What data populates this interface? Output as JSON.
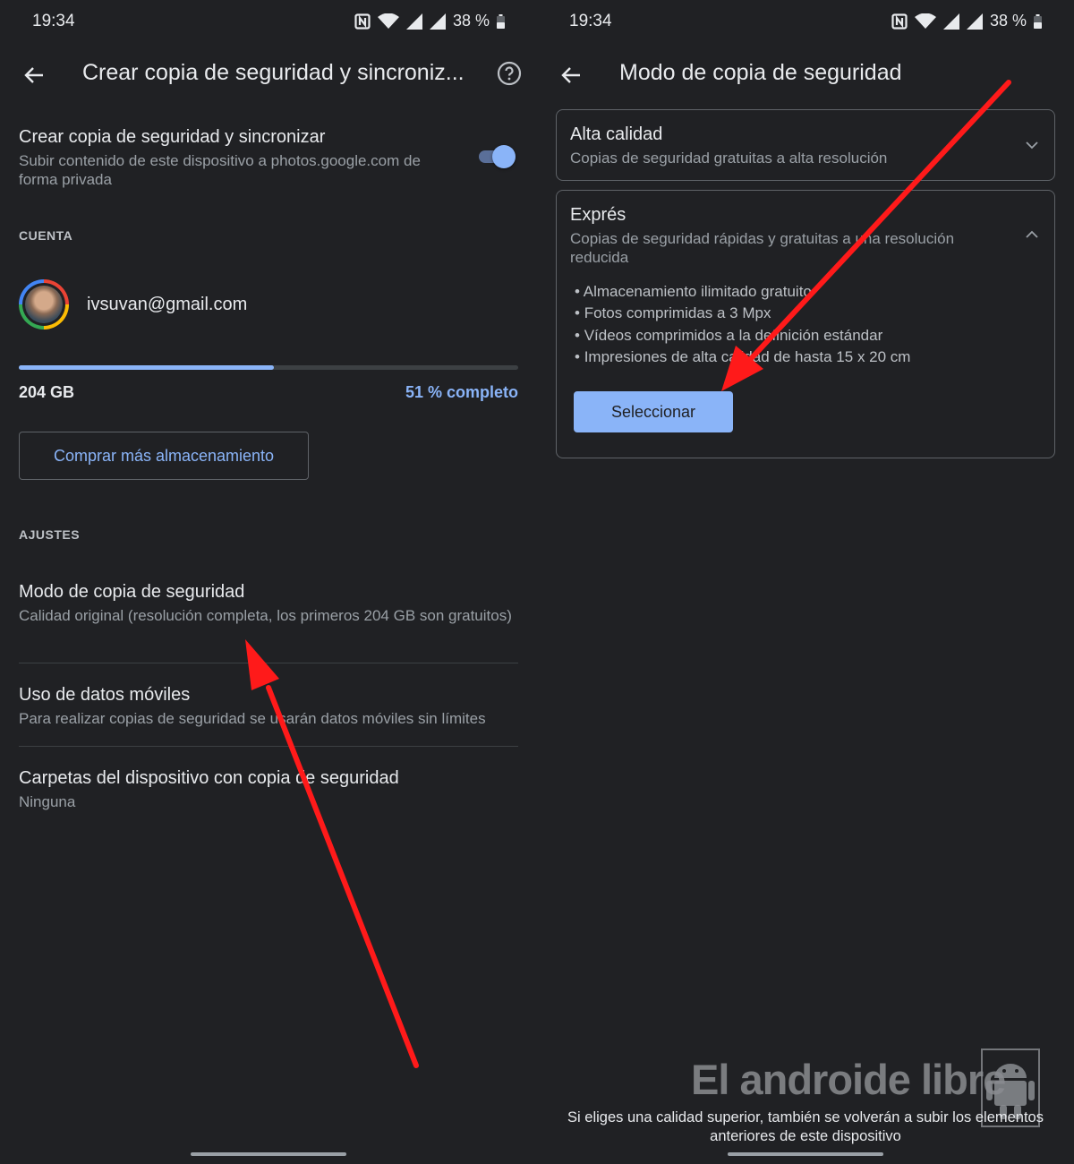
{
  "left": {
    "status": {
      "time": "19:34",
      "battery": "38 %"
    },
    "appbar": {
      "title": "Crear copia de seguridad y sincroniz..."
    },
    "sync": {
      "title": "Crear copia de seguridad y sincronizar",
      "subtitle": "Subir contenido de este dispositivo a photos.google.com de forma privada",
      "enabled": true
    },
    "account": {
      "section": "CUENTA",
      "email": "ivsuvan@gmail.com",
      "storage": "204 GB",
      "percent_text": "51 % completo",
      "progress": 0.51,
      "buy_label": "Comprar más almacenamiento"
    },
    "settings": {
      "section": "AJUSTES",
      "items": [
        {
          "title": "Modo de copia de seguridad",
          "subtitle": "Calidad original (resolución completa, los primeros 204 GB son gratuitos)"
        },
        {
          "title": "Uso de datos móviles",
          "subtitle": "Para realizar copias de seguridad se usarán datos móviles sin límites"
        },
        {
          "title": "Carpetas del dispositivo con copia de seguridad",
          "subtitle": "Ninguna"
        }
      ]
    }
  },
  "right": {
    "status": {
      "time": "19:34",
      "battery": "38 %"
    },
    "appbar": {
      "title": "Modo de copia de seguridad"
    },
    "options": [
      {
        "title": "Alta calidad",
        "subtitle": "Copias de seguridad gratuitas a alta resolución",
        "expanded": false
      },
      {
        "title": "Exprés",
        "subtitle": "Copias de seguridad rápidas y gratuitas a una resolución reducida",
        "expanded": true,
        "bullets": [
          "Almacenamiento ilimitado gratuito",
          "Fotos comprimidas a 3 Mpx",
          "Vídeos comprimidos a la definición estándar",
          "Impresiones de alta calidad de hasta 15 x 20 cm"
        ],
        "button": "Seleccionar"
      }
    ],
    "footer": "Si eliges una calidad superior, también se volverán a subir los elementos anteriores de este dispositivo",
    "watermark": "El androide libre"
  },
  "colors": {
    "background": "#202124",
    "accent": "#8ab4f8",
    "annotation": "#ff1a1a"
  }
}
